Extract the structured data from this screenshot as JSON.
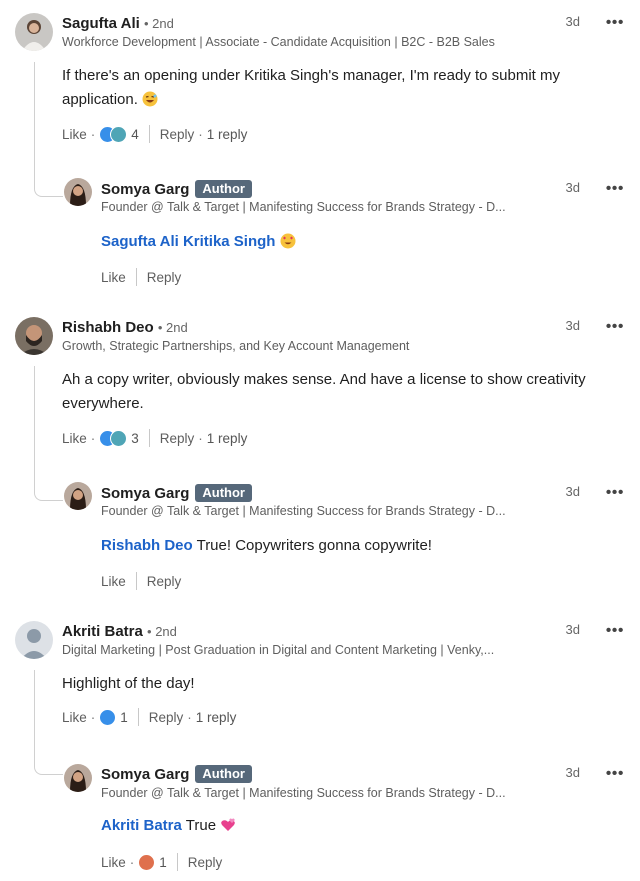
{
  "comments": [
    {
      "name": "Sagufta Ali",
      "degree": "• 2nd",
      "headline": "Workforce Development | Associate - Candidate Acquisition | B2C - B2B Sales",
      "time": "3d",
      "text": " If there's an opening under Kritika Singh's manager, I'm ready to submit my application. ",
      "like": "Like",
      "reactions": "4",
      "reply": "Reply",
      "replies": "1 reply",
      "reply_item": {
        "name": "Somya Garg",
        "badge": "Author",
        "headline": "Founder @ Talk & Target | Manifesting Success for Brands Strategy - D...",
        "time": "3d",
        "mention": "Sagufta Ali Kritika Singh",
        "text": "",
        "like": "Like",
        "reply": "Reply"
      }
    },
    {
      "name": "Rishabh Deo",
      "degree": "• 2nd",
      "headline": "Growth, Strategic Partnerships, and Key Account Management",
      "time": "3d",
      "text": "Ah a copy writer, obviously makes sense. And have a license to show creativity everywhere.",
      "like": "Like",
      "reactions": "3",
      "reply": "Reply",
      "replies": "1 reply",
      "reply_item": {
        "name": "Somya Garg",
        "badge": "Author",
        "headline": "Founder @ Talk & Target | Manifesting Success for Brands Strategy - D...",
        "time": "3d",
        "mention": "Rishabh Deo",
        "text": " True! Copywriters gonna copywrite!",
        "like": "Like",
        "reply": "Reply"
      }
    },
    {
      "name": "Akriti Batra",
      "degree": "• 2nd",
      "headline": "Digital Marketing | Post Graduation in Digital and Content Marketing | Venky,...",
      "time": "3d",
      "text": "Highlight of the day!",
      "like": "Like",
      "reactions": "1",
      "reply": "Reply",
      "replies": "1 reply",
      "reply_item": {
        "name": "Somya Garg",
        "badge": "Author",
        "headline": "Founder @ Talk & Target | Manifesting Success for Brands Strategy - D...",
        "time": "3d",
        "mention": "Akriti Batra",
        "text": " True ",
        "like": "Like",
        "reactions": "1",
        "reply": "Reply"
      }
    }
  ],
  "icons": {
    "more": "more-options-icon",
    "like_reaction": "like-reaction-icon",
    "support_reaction": "support-reaction-icon",
    "heart_reaction": "heart-reaction-icon"
  },
  "colors": {
    "mention": "#1d63c9",
    "badge": "#56687a",
    "like_blue": "#378fe9",
    "support_teal": "#5f9b41"
  }
}
